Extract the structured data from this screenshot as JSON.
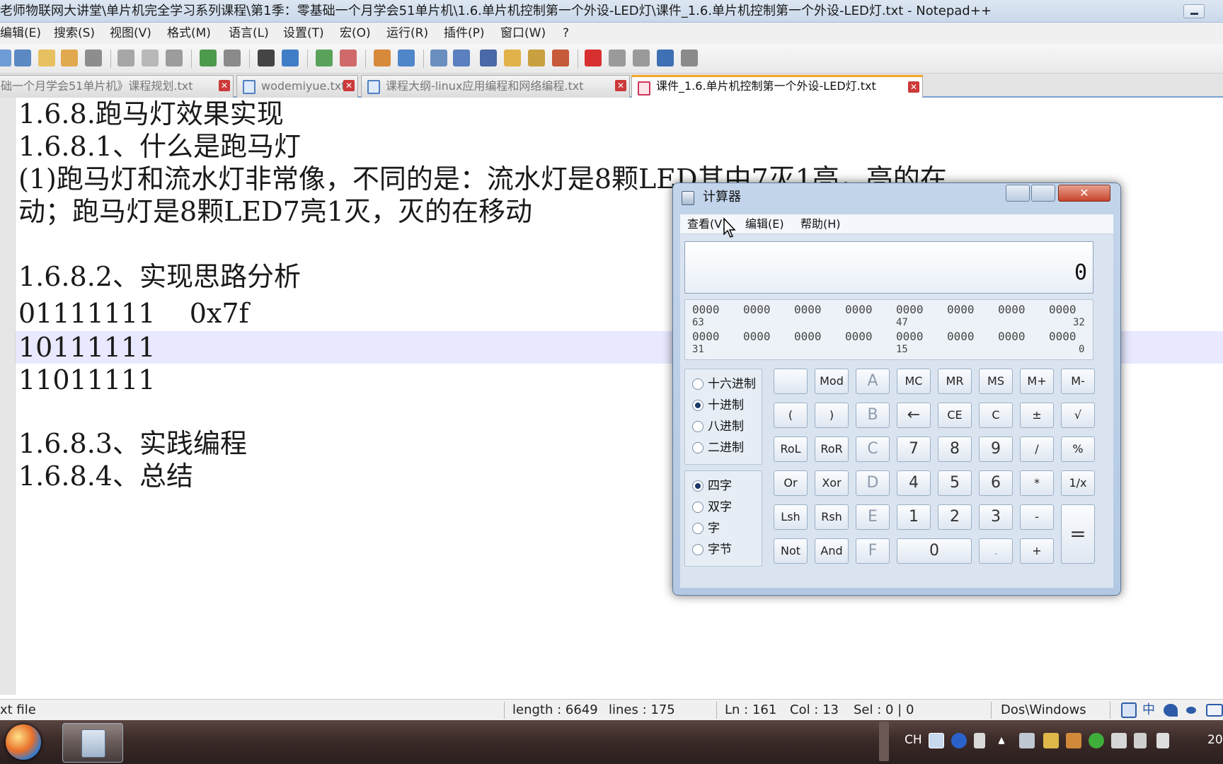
{
  "window": {
    "title": "老师物联网大讲堂\\单片机完全学习系列课程\\第1季：零基础一个月学会51单片机\\1.6.单片机控制第一个外设-LED灯\\课件_1.6.单片机控制第一个外设-LED灯.txt - Notepad++"
  },
  "menu": [
    "编辑(E)",
    "搜索(S)",
    "视图(V)",
    "格式(M)",
    "语言(L)",
    "设置(T)",
    "宏(O)",
    "运行(R)",
    "插件(P)",
    "窗口(W)",
    "?"
  ],
  "tabs": [
    {
      "label": "础一个月学会51单片机》课程规划.txt",
      "active": false
    },
    {
      "label": "wodemiyue.txt",
      "active": false
    },
    {
      "label": "课程大纲-linux应用编程和网络编程.txt",
      "active": false
    },
    {
      "label": "课件_1.6.单片机控制第一个外设-LED灯.txt",
      "active": true
    }
  ],
  "editor": {
    "lines": [
      "1.6.8.跑马灯效果实现",
      "1.6.8.1、什么是跑马灯",
      "(1)跑马灯和流水灯非常像，不同的是：流水灯是8颗LED其中7灭1亮，亮的在",
      "动；跑马灯是8颗LED7亮1灭，灭的在移动",
      "",
      "1.6.8.2、实现思路分析",
      "01111111    0x7f",
      "10111111",
      "11011111",
      "",
      "1.6.8.3、实践编程",
      "1.6.8.4、总结"
    ]
  },
  "status": {
    "filetype": "xt file",
    "length": "length : 6649",
    "lines": "lines : 175",
    "ln": "Ln : 161",
    "col": "Col : 13",
    "sel": "Sel : 0 | 0",
    "eol": "Dos\\Windows"
  },
  "calculator": {
    "title": "计算器",
    "menu": [
      "查看(V)",
      "编辑(E)",
      "帮助(H)"
    ],
    "display": "0",
    "bits_row1": [
      "0000",
      "0000",
      "0000",
      "0000",
      "0000",
      "0000",
      "0000",
      "0000"
    ],
    "bits_row1_marks": [
      "63",
      "47",
      "32"
    ],
    "bits_row2": [
      "0000",
      "0000",
      "0000",
      "0000",
      "0000",
      "0000",
      "0000",
      "0000"
    ],
    "bits_row2_marks": [
      "31",
      "15",
      "0"
    ],
    "base_options": [
      "十六进制",
      "十进制",
      "八进制",
      "二进制"
    ],
    "base_selected": 1,
    "word_options": [
      "四字",
      "双字",
      "字",
      "字节"
    ],
    "word_selected": 0,
    "keys": [
      [
        "",
        "Mod",
        "A",
        "MC",
        "MR",
        "MS",
        "M+",
        "M-"
      ],
      [
        "(",
        ")",
        "B",
        "←",
        "CE",
        "C",
        "±",
        "√"
      ],
      [
        "RoL",
        "RoR",
        "C",
        "7",
        "8",
        "9",
        "/",
        "%"
      ],
      [
        "Or",
        "Xor",
        "D",
        "4",
        "5",
        "6",
        "*",
        "1/x"
      ],
      [
        "Lsh",
        "Rsh",
        "E",
        "1",
        "2",
        "3",
        "-",
        "="
      ],
      [
        "Not",
        "And",
        "F",
        "0",
        ".",
        "+"
      ]
    ]
  },
  "taskbar": {
    "lang": "CH",
    "ime": "中",
    "clock_fragment": "20"
  }
}
